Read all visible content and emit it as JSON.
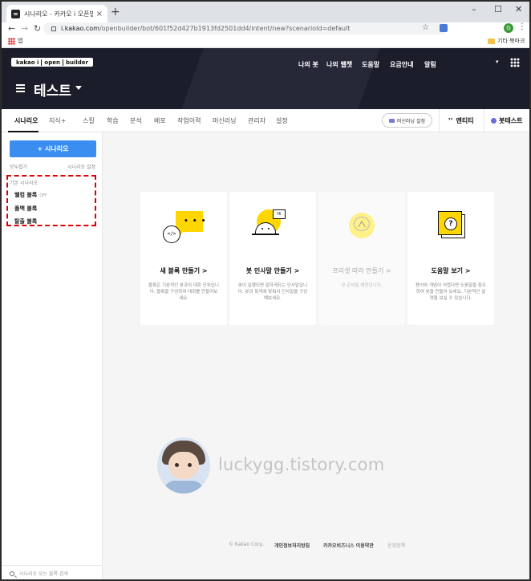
{
  "browser": {
    "tab_title": "시나리오 - 카카오 i 오픈빌더",
    "tab_close": "×",
    "new_tab": "+",
    "window_controls": [
      "–",
      "☐",
      "✕"
    ],
    "url_host": "i.kakao.com",
    "url_path": "/openbuilder/bot/601f52d427b1913fd2501dd4/intent/new?scenarioId=default",
    "profile_initial": "G",
    "bookmarks": {
      "apps_label": "앱",
      "other_label": "기타 북마크"
    }
  },
  "header": {
    "logo_parts": [
      "kakao i",
      "open",
      "builder"
    ],
    "nav": [
      "나의 봇",
      "나의 웹챗",
      "도움말",
      "요금안내",
      "알림"
    ],
    "bot_name": "테스트"
  },
  "tabs": {
    "items": [
      "시나리오",
      "지식+",
      "스킬",
      "학습",
      "분석",
      "배포",
      "작업이력",
      "머신러닝",
      "관리자",
      "설정"
    ],
    "ml_settings_label": "머신러닝 설정",
    "entity_label": "엔티티",
    "bottest_label": "봇테스트"
  },
  "sidebar": {
    "add_button": "+ 시나리오",
    "collapse_all": "모두접기",
    "scenario_settings": "시나리오 설정",
    "default_scenario": "기본 시나리오",
    "items": [
      {
        "label": "웰컴 블록",
        "badge": "OFF"
      },
      {
        "label": "폴백 블록",
        "badge": ""
      },
      {
        "label": "탈출 블록",
        "badge": ""
      }
    ],
    "search_placeholder": "시나리오 또는 블록 검색"
  },
  "cards": [
    {
      "title": "새 블록 만들기 >",
      "desc": "블록은 기본적인 봇과의 대화 단위입니다. 블록을 구성하여 대화를 만들어보세요.",
      "disabled": false,
      "icon": "new-block-icon"
    },
    {
      "title": "봇 인사말 만들기 >",
      "desc": "봇이 실행되면 말하게되는 인사말입니다. 봇의 특색에 맞춰서 인사말을 구성해보세요.",
      "disabled": false,
      "icon": "greeting-icon"
    },
    {
      "title": "프리셋 따라 만들기 >",
      "desc": "곧 준비될 예정입니다.",
      "disabled": true,
      "icon": "preset-icon"
    },
    {
      "title": "도움말 보기 >",
      "desc": "용어와 개념이 어렵다면 도움말을 참조하여 봇을 만들어 보세요. 기본적인 설명을 보실 수 있습니다.",
      "disabled": false,
      "icon": "help-icon"
    }
  ],
  "card_illus_text": {
    "dots": "• • •",
    "code": "</>",
    "hi": "Hi",
    "question": "?"
  },
  "watermark": "luckygg.tistory.com",
  "footer": {
    "copyright": "© Kakao Corp.",
    "privacy": "개인정보처리방침",
    "terms": "카카오비즈니스 이용약관",
    "policy": "운영정책"
  },
  "colors": {
    "header_bg": "#1c1d2b",
    "primary": "#3b8ef0",
    "accent_yellow": "#ffd600",
    "highlight_dash": "#dd0000"
  }
}
